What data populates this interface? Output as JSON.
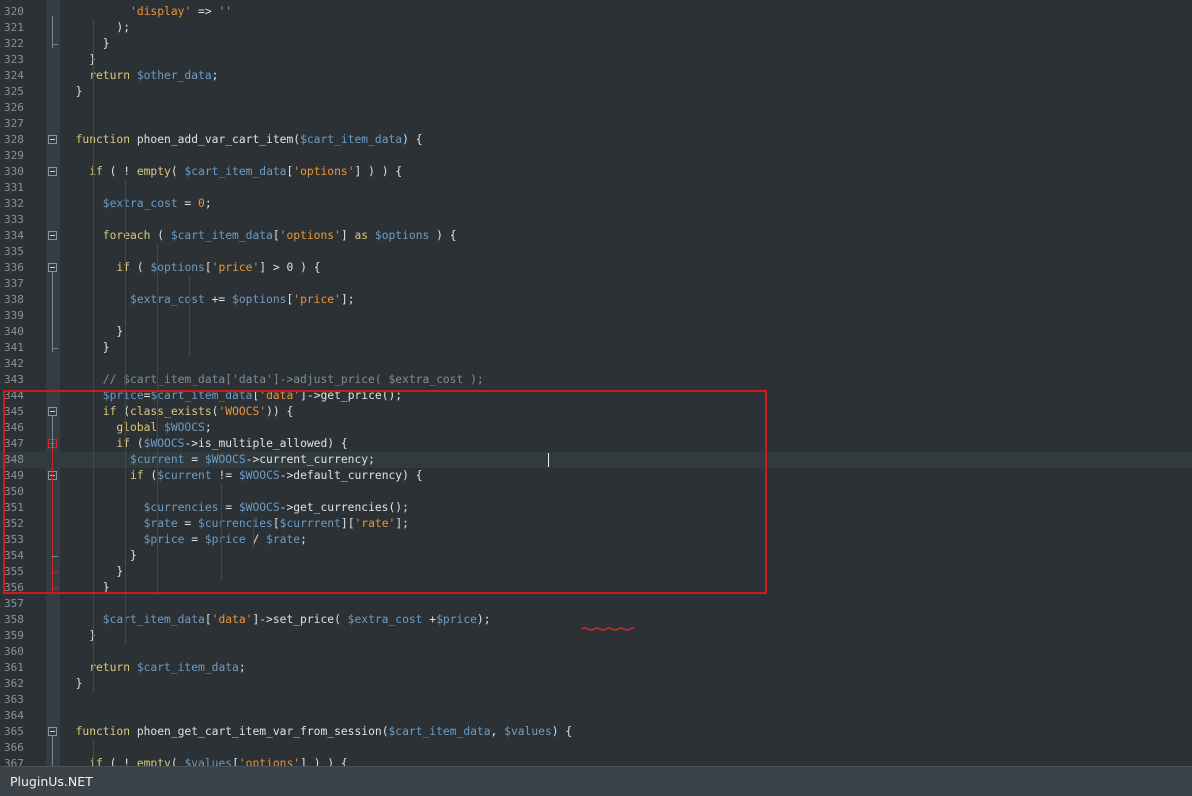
{
  "lines": [
    {
      "n": "320",
      "tokens": [
        [
          "t-",
          "          "
        ],
        [
          "t-s",
          "'display'"
        ],
        [
          "t-p",
          " => "
        ],
        [
          "t-s",
          "''"
        ]
      ]
    },
    {
      "n": "321",
      "tokens": [
        [
          "t-p",
          "        );"
        ]
      ]
    },
    {
      "n": "322",
      "tokens": [
        [
          "t-p",
          "      }"
        ]
      ]
    },
    {
      "n": "323",
      "tokens": [
        [
          "t-p",
          "    }"
        ]
      ]
    },
    {
      "n": "324",
      "tokens": [
        [
          "t-k",
          "    return "
        ],
        [
          "t-v",
          "$other_data"
        ],
        [
          "t-p",
          ";"
        ]
      ]
    },
    {
      "n": "325",
      "tokens": [
        [
          "t-p",
          "  }"
        ]
      ]
    },
    {
      "n": "326",
      "tokens": []
    },
    {
      "n": "327",
      "tokens": []
    },
    {
      "n": "328",
      "tokens": [
        [
          "t-k",
          "  function "
        ],
        [
          "t-f",
          "phoen_add_var_cart_item"
        ],
        [
          "t-p",
          "("
        ],
        [
          "t-v",
          "$cart_item_data"
        ],
        [
          "t-p",
          ") {"
        ]
      ]
    },
    {
      "n": "329",
      "tokens": []
    },
    {
      "n": "330",
      "tokens": [
        [
          "t-k",
          "    if "
        ],
        [
          "t-p",
          "( ! "
        ],
        [
          "t-k",
          "empty"
        ],
        [
          "t-p",
          "( "
        ],
        [
          "t-v",
          "$cart_item_data"
        ],
        [
          "t-p",
          "["
        ],
        [
          "t-s",
          "'options'"
        ],
        [
          "t-p",
          "] ) ) {"
        ]
      ]
    },
    {
      "n": "331",
      "tokens": []
    },
    {
      "n": "332",
      "tokens": [
        [
          "t-v",
          "      $extra_cost"
        ],
        [
          "t-p",
          " = "
        ],
        [
          "t-s",
          "0"
        ],
        [
          "t-p",
          ";"
        ]
      ]
    },
    {
      "n": "333",
      "tokens": []
    },
    {
      "n": "334",
      "tokens": [
        [
          "t-k",
          "      foreach "
        ],
        [
          "t-p",
          "( "
        ],
        [
          "t-v",
          "$cart_item_data"
        ],
        [
          "t-p",
          "["
        ],
        [
          "t-s",
          "'options'"
        ],
        [
          "t-p",
          "] "
        ],
        [
          "t-k",
          "as "
        ],
        [
          "t-v",
          "$options"
        ],
        [
          "t-p",
          " ) {"
        ]
      ]
    },
    {
      "n": "335",
      "tokens": []
    },
    {
      "n": "336",
      "tokens": [
        [
          "t-k",
          "        if "
        ],
        [
          "t-p",
          "( "
        ],
        [
          "t-v",
          "$options"
        ],
        [
          "t-p",
          "["
        ],
        [
          "t-s",
          "'price'"
        ],
        [
          "t-p",
          "] > 0 ) {"
        ]
      ]
    },
    {
      "n": "337",
      "tokens": []
    },
    {
      "n": "338",
      "tokens": [
        [
          "t-v",
          "          $extra_cost"
        ],
        [
          "t-p",
          " += "
        ],
        [
          "t-v",
          "$options"
        ],
        [
          "t-p",
          "["
        ],
        [
          "t-s",
          "'price'"
        ],
        [
          "t-p",
          "];"
        ]
      ]
    },
    {
      "n": "339",
      "tokens": []
    },
    {
      "n": "340",
      "tokens": [
        [
          "t-p",
          "        }"
        ]
      ]
    },
    {
      "n": "341",
      "tokens": [
        [
          "t-p",
          "      }"
        ]
      ]
    },
    {
      "n": "342",
      "tokens": []
    },
    {
      "n": "343",
      "tokens": [
        [
          "t-c",
          "      // $cart_item_data['data']->adjust_price( $extra_cost );"
        ]
      ]
    },
    {
      "n": "344",
      "tokens": [
        [
          "t-v",
          "      $price"
        ],
        [
          "t-p",
          "="
        ],
        [
          "t-v",
          "$cart_item_data"
        ],
        [
          "t-p",
          "["
        ],
        [
          "t-s",
          "'data'"
        ],
        [
          "t-p",
          "]->get_price();"
        ]
      ]
    },
    {
      "n": "345",
      "tokens": [
        [
          "t-k",
          "      if "
        ],
        [
          "t-p",
          "("
        ],
        [
          "t-k",
          "class_exists"
        ],
        [
          "t-p",
          "("
        ],
        [
          "t-s",
          "'WOOCS'"
        ],
        [
          "t-p",
          ")) {"
        ]
      ]
    },
    {
      "n": "346",
      "tokens": [
        [
          "t-k",
          "        global "
        ],
        [
          "t-v",
          "$WOOCS"
        ],
        [
          "t-p",
          ";"
        ]
      ]
    },
    {
      "n": "347",
      "tokens": [
        [
          "t-k",
          "        if "
        ],
        [
          "t-p",
          "("
        ],
        [
          "t-v",
          "$WOOCS"
        ],
        [
          "t-p",
          "->is_multiple_allowed) {"
        ]
      ]
    },
    {
      "n": "348",
      "tokens": [
        [
          "t-v",
          "          $current"
        ],
        [
          "t-p",
          " = "
        ],
        [
          "t-v",
          "$WOOCS"
        ],
        [
          "t-p",
          "->current_currency;"
        ]
      ]
    },
    {
      "n": "349",
      "tokens": [
        [
          "t-k",
          "          if "
        ],
        [
          "t-p",
          "("
        ],
        [
          "t-v",
          "$current"
        ],
        [
          "t-p",
          " != "
        ],
        [
          "t-v",
          "$WOOCS"
        ],
        [
          "t-p",
          "->default_currency) {"
        ]
      ]
    },
    {
      "n": "350",
      "tokens": []
    },
    {
      "n": "351",
      "tokens": [
        [
          "t-v",
          "            $currencies"
        ],
        [
          "t-p",
          " = "
        ],
        [
          "t-v",
          "$WOOCS"
        ],
        [
          "t-p",
          "->get_currencies();"
        ]
      ]
    },
    {
      "n": "352",
      "tokens": [
        [
          "t-v",
          "            $rate"
        ],
        [
          "t-p",
          " = "
        ],
        [
          "t-v",
          "$currencies"
        ],
        [
          "t-p",
          "["
        ],
        [
          "t-v",
          "$currrent"
        ],
        [
          "t-p",
          "]["
        ],
        [
          "t-s",
          "'rate'"
        ],
        [
          "t-p",
          "];"
        ]
      ]
    },
    {
      "n": "353",
      "tokens": [
        [
          "t-v",
          "            $price"
        ],
        [
          "t-p",
          " = "
        ],
        [
          "t-v",
          "$price"
        ],
        [
          "t-p",
          " / "
        ],
        [
          "t-v",
          "$rate"
        ],
        [
          "t-p",
          ";"
        ]
      ]
    },
    {
      "n": "354",
      "tokens": [
        [
          "t-p",
          "          }"
        ]
      ]
    },
    {
      "n": "355",
      "tokens": [
        [
          "t-p",
          "        }"
        ]
      ]
    },
    {
      "n": "356",
      "tokens": [
        [
          "t-p",
          "      }"
        ]
      ]
    },
    {
      "n": "357",
      "tokens": []
    },
    {
      "n": "358",
      "tokens": [
        [
          "t-v",
          "      $cart_item_data"
        ],
        [
          "t-p",
          "["
        ],
        [
          "t-s",
          "'data'"
        ],
        [
          "t-p",
          "]->set_price( "
        ],
        [
          "t-v",
          "$extra_cost"
        ],
        [
          "t-p",
          " +"
        ],
        [
          "t-v",
          "$price"
        ],
        [
          "t-p",
          ");"
        ]
      ]
    },
    {
      "n": "359",
      "tokens": [
        [
          "t-p",
          "    }"
        ]
      ]
    },
    {
      "n": "360",
      "tokens": []
    },
    {
      "n": "361",
      "tokens": [
        [
          "t-k",
          "    return "
        ],
        [
          "t-v",
          "$cart_item_data"
        ],
        [
          "t-p",
          ";"
        ]
      ]
    },
    {
      "n": "362",
      "tokens": [
        [
          "t-p",
          "  }"
        ]
      ]
    },
    {
      "n": "363",
      "tokens": []
    },
    {
      "n": "364",
      "tokens": []
    },
    {
      "n": "365",
      "tokens": [
        [
          "t-k",
          "  function "
        ],
        [
          "t-f",
          "phoen_get_cart_item_var_from_session"
        ],
        [
          "t-p",
          "("
        ],
        [
          "t-v",
          "$cart_item_data"
        ],
        [
          "t-p",
          ", "
        ],
        [
          "t-v",
          "$values"
        ],
        [
          "t-p",
          ") {"
        ]
      ]
    },
    {
      "n": "366",
      "tokens": []
    },
    {
      "n": "367",
      "tokens": [
        [
          "t-k",
          "    if "
        ],
        [
          "t-p",
          "( ! "
        ],
        [
          "t-k",
          "empty"
        ],
        [
          "t-p",
          "( "
        ],
        [
          "t-v",
          "$values"
        ],
        [
          "t-p",
          "["
        ],
        [
          "t-s",
          "'options'"
        ],
        [
          "t-p",
          "] ) ) {"
        ]
      ]
    }
  ],
  "theme": {
    "background": "#2b3135",
    "keyword": "#d9c97c",
    "variable": "#6f9cc2",
    "string": "#e8953c",
    "comment": "#7e8e99",
    "plain": "#e0e2e4",
    "highlight_box": "#d01a1a"
  },
  "status": {
    "brand": "PluginUs.NET"
  }
}
